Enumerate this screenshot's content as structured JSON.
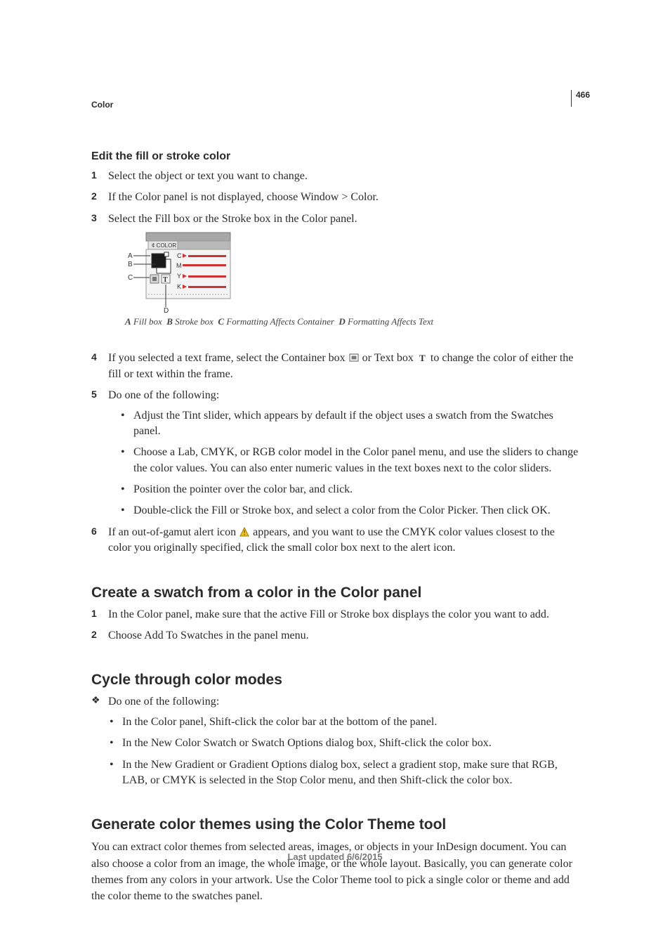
{
  "page_number": "466",
  "running_head": "Color",
  "footer": "Last updated 6/6/2015",
  "sec1": {
    "heading": "Edit the fill or stroke color",
    "steps": {
      "s1": "Select the object or text you want to change.",
      "s2": "If the Color panel is not displayed, choose Window > Color.",
      "s3": "Select the Fill box or the Stroke box in the Color panel.",
      "s4_a": "If you selected a text frame, select the Container box ",
      "s4_b": " or Text box ",
      "s4_c": " to change the color of either the fill or text within the frame.",
      "s5_lead": "Do one of the following:",
      "s5_b1": "Adjust the Tint slider, which appears by default if the object uses a swatch from the Swatches panel.",
      "s5_b2": "Choose a Lab, CMYK, or RGB color model in the Color panel menu, and use the sliders to change the color values. You can also enter numeric values in the text boxes next to the color sliders.",
      "s5_b3": "Position the pointer over the color bar, and click.",
      "s5_b4": "Double-click the Fill or Stroke box, and select a color from the Color Picker. Then click OK.",
      "s6_a": "If an out-of-gamut alert icon ",
      "s6_b": " appears, and you want to use the CMYK color values closest to the color you originally specified, click the small color box next to the alert icon."
    },
    "caption": {
      "A": "A",
      "A_txt": "Fill box",
      "B": "B",
      "B_txt": "Stroke box",
      "C": "C",
      "C_txt": "Formatting Affects Container",
      "D": "D",
      "D_txt": "Formatting Affects Text"
    }
  },
  "sec2": {
    "heading": "Create a swatch from a color in the Color panel",
    "s1": "In the Color panel, make sure that the active Fill or Stroke box displays the color you want to add.",
    "s2": "Choose Add To Swatches in the panel menu."
  },
  "sec3": {
    "heading": "Cycle through color modes",
    "lead": "Do one of the following:",
    "b1": "In the Color panel, Shift-click the color bar at the bottom of the panel.",
    "b2": "In the New Color Swatch or Swatch Options dialog box, Shift-click the color box.",
    "b3": "In the New Gradient or Gradient Options dialog box, select a gradient stop, make sure that RGB, LAB, or CMYK is selected in the Stop Color menu, and then Shift-click the color box."
  },
  "sec4": {
    "heading": "Generate color themes using the Color Theme tool",
    "body": "You can extract color themes from selected areas, images, or objects in your InDesign document. You can also choose a color from an image, the whole image, or the whole layout. Basically, you can generate color themes from any colors in your artwork. Use the Color Theme tool to pick a single color or theme and add the color theme to the swatches panel."
  }
}
